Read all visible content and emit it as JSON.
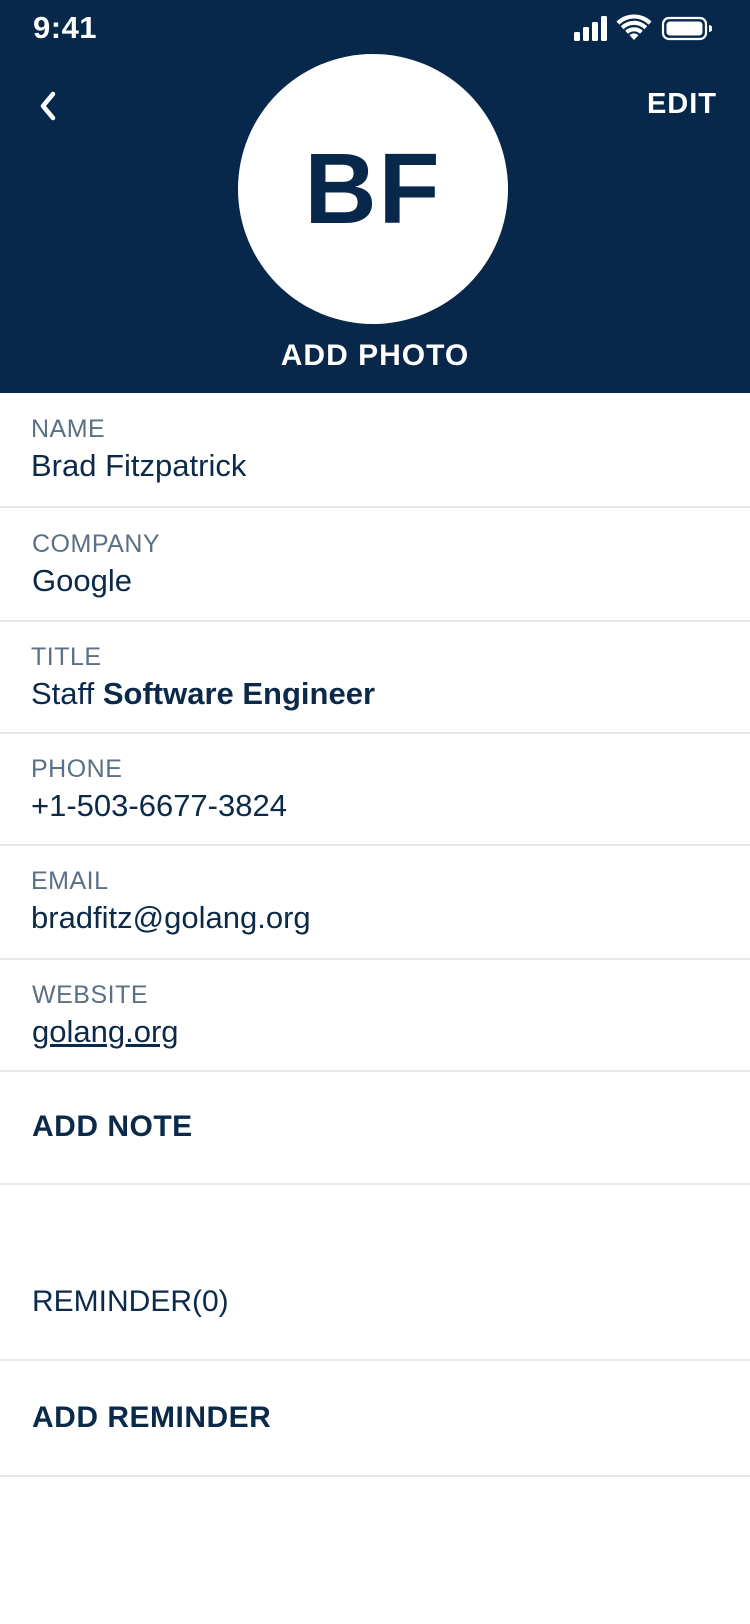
{
  "status_bar": {
    "time": "9:41",
    "icons": [
      "cellular-signal-icon",
      "wifi-icon",
      "battery-icon"
    ]
  },
  "header": {
    "back_icon": "chevron-left-icon",
    "edit_label": "EDIT",
    "initials": "BF",
    "add_photo_label": "ADD PHOTO"
  },
  "fields": {
    "name": {
      "label": "NAME",
      "value": "Brad Fitzpatrick"
    },
    "company": {
      "label": "COMPANY",
      "value": "Google"
    },
    "title": {
      "label": "TITLE",
      "value_prefix": "Staff",
      "value_bold": "Software Engineer"
    },
    "phone": {
      "label": "PHONE",
      "value": "+1-503-6677-3824"
    },
    "email": {
      "label": "EMAIL",
      "value": "bradfitz@golang.org"
    },
    "website": {
      "label": "WEBSITE",
      "value": "golang.org"
    }
  },
  "actions": {
    "add_note": "ADD NOTE",
    "reminder_count": "REMINDER(0)",
    "add_reminder": "ADD REMINDER"
  },
  "colors": {
    "header_bg": "#07284b",
    "text_primary": "#0b2a4a",
    "text_label": "#5b6f85",
    "divider": "#e6e8eb"
  }
}
